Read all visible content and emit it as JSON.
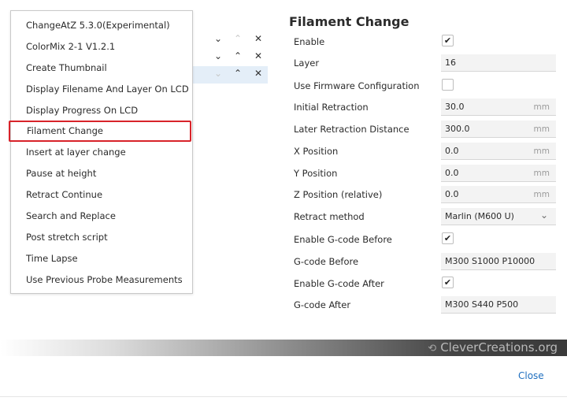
{
  "script_menu": {
    "items": [
      "ChangeAtZ 5.3.0(Experimental)",
      "ColorMix 2-1 V1.2.1",
      "Create Thumbnail",
      "Display Filename And Layer On LCD",
      "Display Progress On LCD",
      "Filament Change",
      "Insert at layer change",
      "Pause at height",
      "Retract Continue",
      "Search and Replace",
      "Post stretch script",
      "Time Lapse",
      "Use Previous Probe Measurements"
    ],
    "highlighted": "Filament Change"
  },
  "active_scripts_controls": {
    "down": "⌄",
    "up": "⌃",
    "remove": "✕"
  },
  "settings": {
    "title": "Filament Change",
    "enable": {
      "label": "Enable",
      "checked": "✔"
    },
    "layer": {
      "label": "Layer",
      "value": "16"
    },
    "use_firmware": {
      "label": "Use Firmware Configuration",
      "checked": ""
    },
    "initial_retraction": {
      "label": "Initial Retraction",
      "value": "30.0",
      "unit": "mm"
    },
    "later_retraction": {
      "label": "Later Retraction Distance",
      "value": "300.0",
      "unit": "mm"
    },
    "x_position": {
      "label": "X Position",
      "value": "0.0",
      "unit": "mm"
    },
    "y_position": {
      "label": "Y Position",
      "value": "0.0",
      "unit": "mm"
    },
    "z_position": {
      "label": "Z Position (relative)",
      "value": "0.0",
      "unit": "mm"
    },
    "retract_method": {
      "label": "Retract method",
      "value": "Marlin (M600 U)"
    },
    "enable_gcode_before": {
      "label": "Enable G-code Before",
      "checked": "✔"
    },
    "gcode_before": {
      "label": "G-code Before",
      "value": "M300 S1000 P10000"
    },
    "enable_gcode_after": {
      "label": "Enable G-code After",
      "checked": "✔"
    },
    "gcode_after": {
      "label": "G-code After",
      "value": "M300 S440 P500"
    }
  },
  "watermark": {
    "text": "CleverCreations.org"
  },
  "footer": {
    "close_label": "Close"
  },
  "colors": {
    "highlight_border": "#d8232a",
    "link": "#1f6fbf"
  }
}
